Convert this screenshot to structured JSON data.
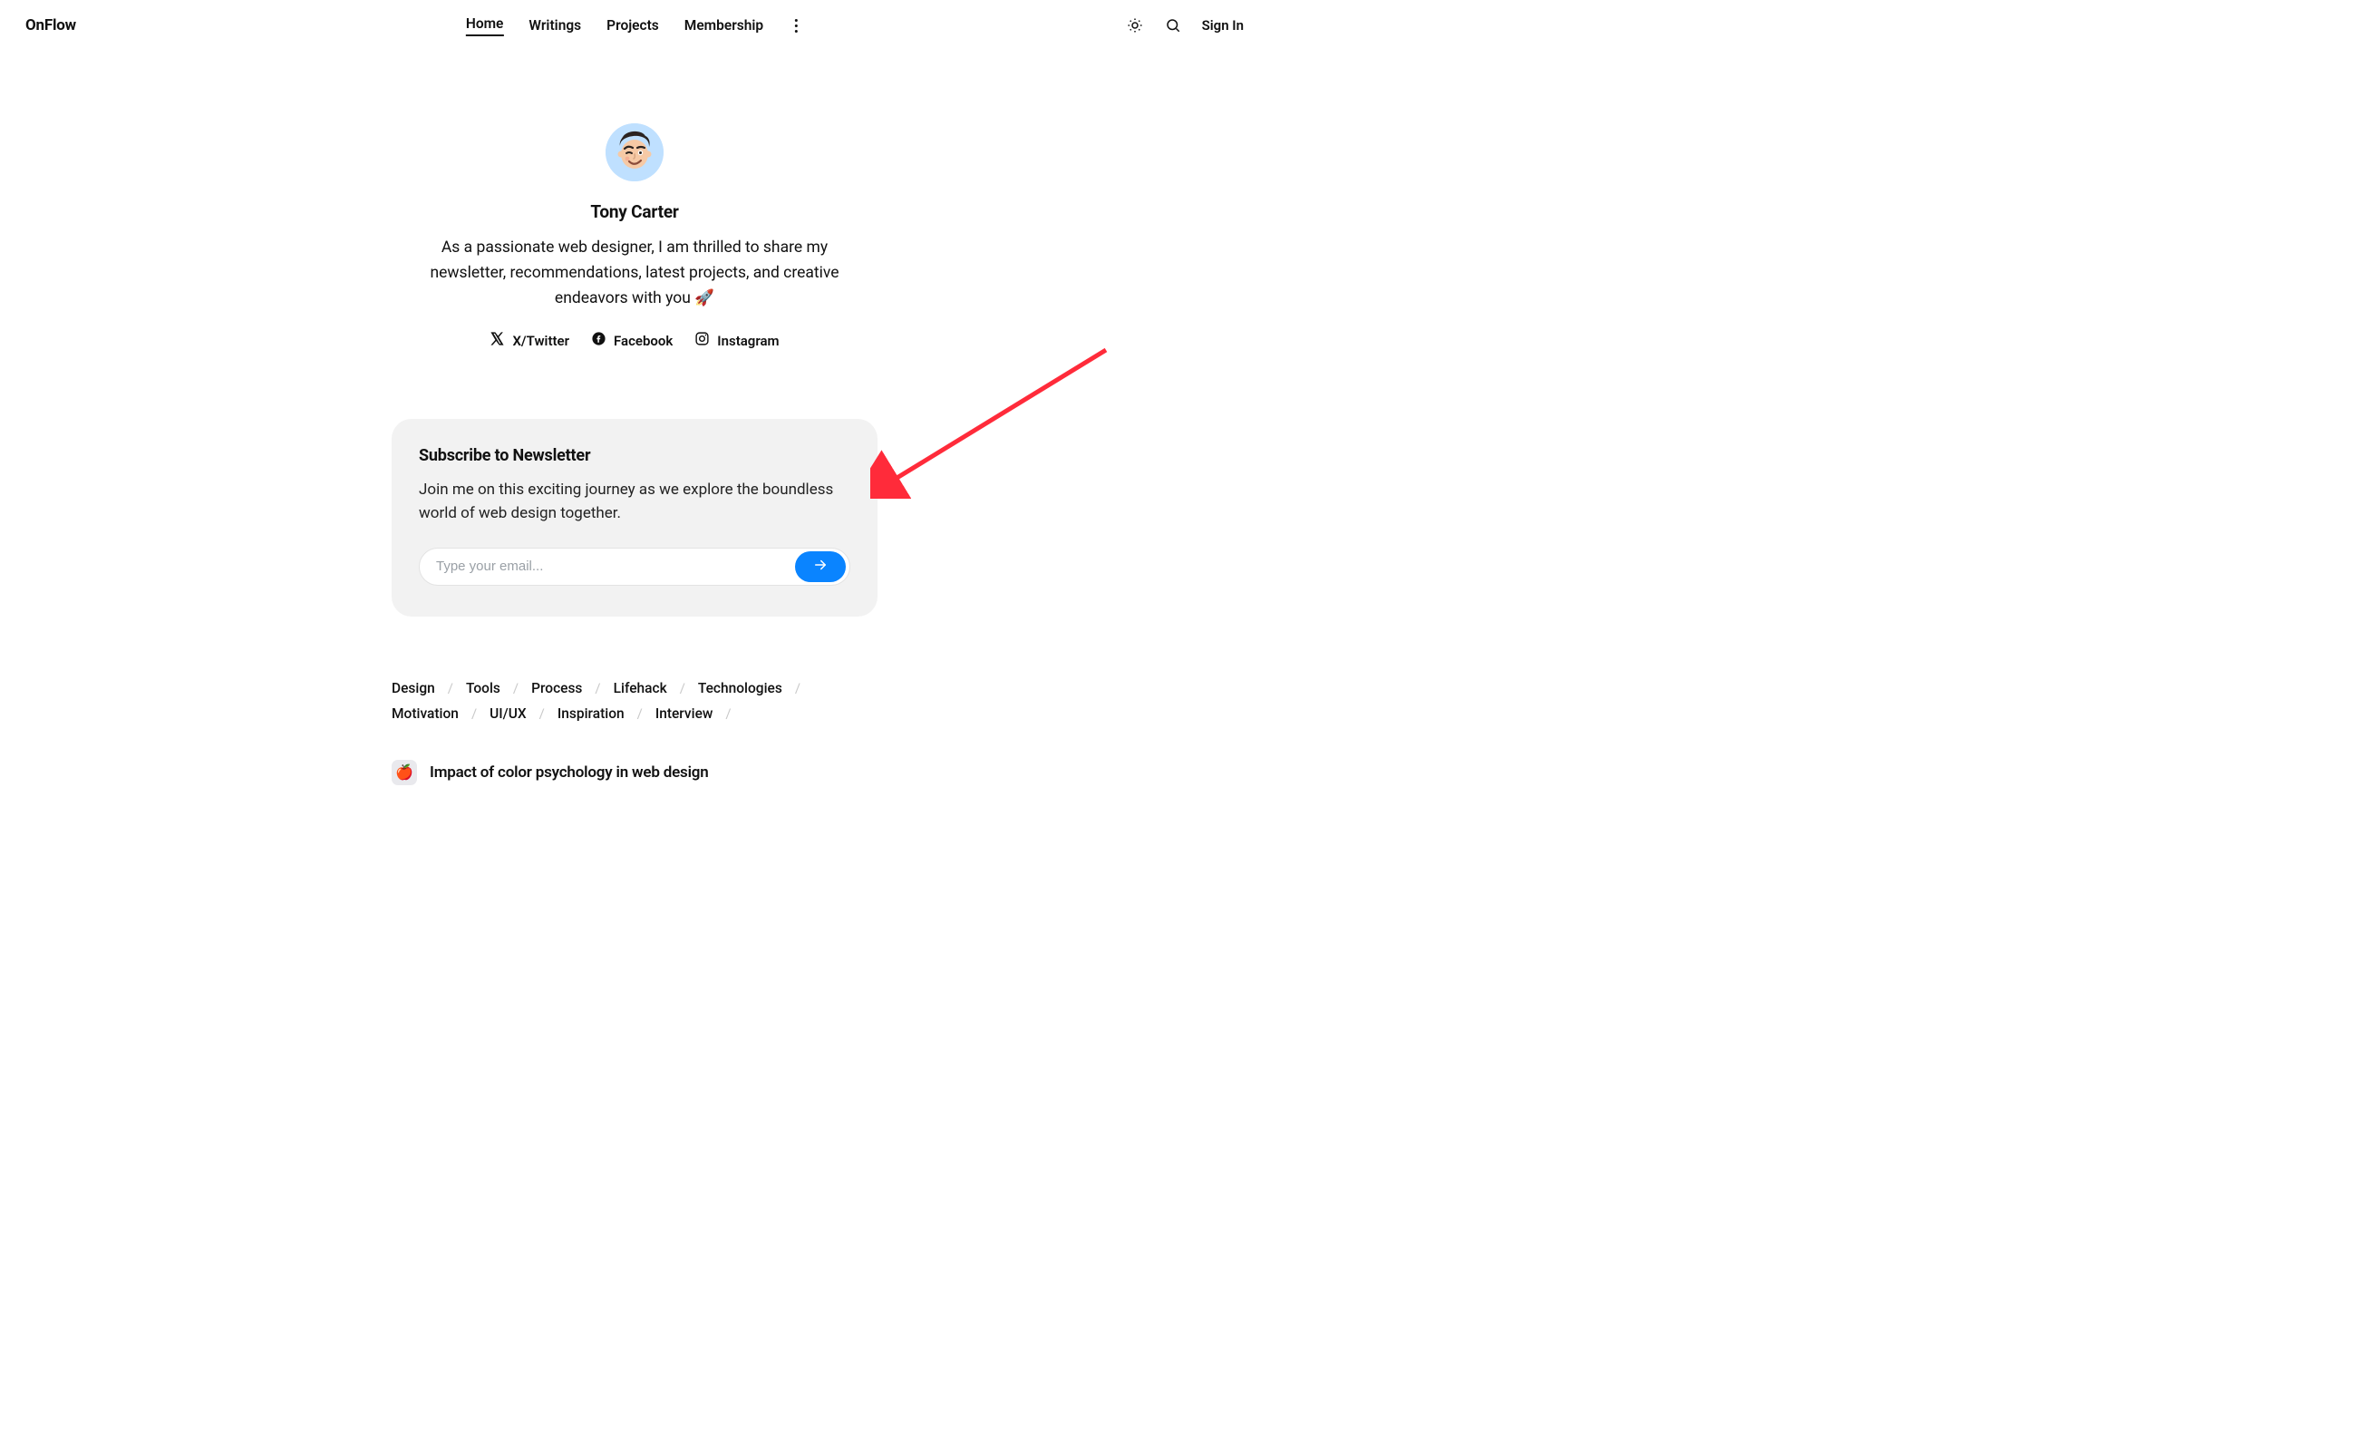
{
  "brand": "OnFlow",
  "nav": {
    "items": [
      {
        "label": "Home",
        "active": true
      },
      {
        "label": "Writings",
        "active": false
      },
      {
        "label": "Projects",
        "active": false
      },
      {
        "label": "Membership",
        "active": false
      }
    ],
    "signin": "Sign In"
  },
  "hero": {
    "name": "Tony Carter",
    "bio": "As a passionate web designer, I am thrilled to share my newsletter, recommendations, latest projects, and creative endeavors with you 🚀"
  },
  "socials": [
    {
      "label": "X/Twitter",
      "icon": "x"
    },
    {
      "label": "Facebook",
      "icon": "fb"
    },
    {
      "label": "Instagram",
      "icon": "ig"
    }
  ],
  "newsletter": {
    "title": "Subscribe to Newsletter",
    "desc": "Join me on this exciting journey as we explore the boundless world of web design together.",
    "placeholder": "Type your email..."
  },
  "tags": [
    "Design",
    "Tools",
    "Process",
    "Lifehack",
    "Technologies",
    "Motivation",
    "UI/UX",
    "Inspiration",
    "Interview"
  ],
  "post": {
    "thumb": "🍎",
    "title": "Impact of color psychology in web design"
  }
}
